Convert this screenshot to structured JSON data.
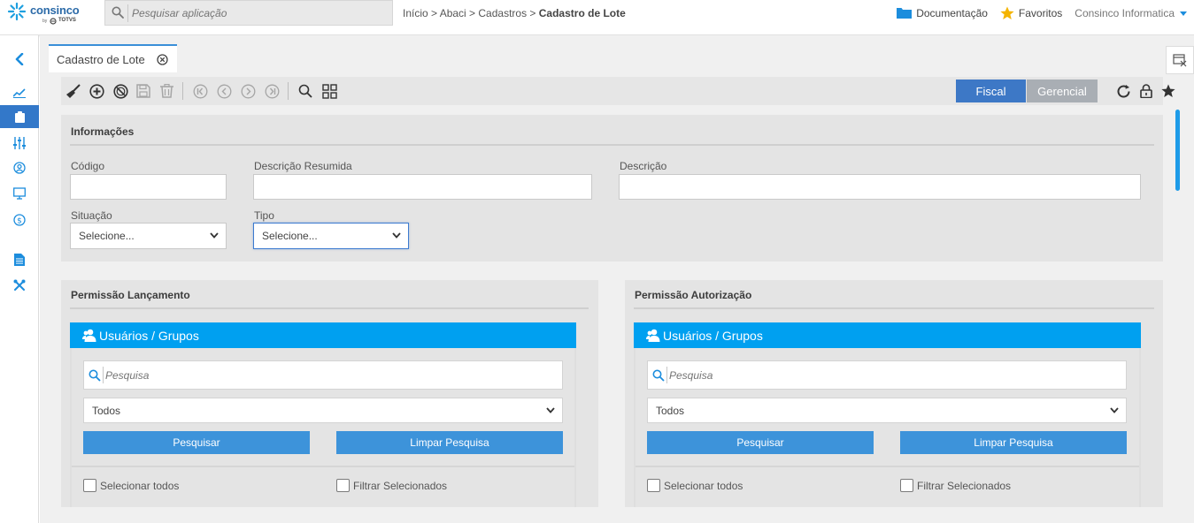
{
  "brand": {
    "name": "consinco",
    "by": "by",
    "partner": "TOTVS"
  },
  "search_app": {
    "placeholder": "Pesquisar aplicação"
  },
  "breadcrumb": {
    "path": "Início > Abaci > Cadastros > ",
    "current": "Cadastro de Lote"
  },
  "header_links": {
    "documentation": "Documentação",
    "favorites": "Favoritos",
    "company": "Consinco Informatica"
  },
  "colors": {
    "accent": "#00a0f0",
    "sidebar_active": "#3378c9",
    "fiscal": "#3d78c6",
    "gerencial": "#a9aeb4",
    "button": "#3d93da"
  },
  "tabs": [
    {
      "label": "Cadastro de Lote",
      "icon": "close-circle-icon"
    }
  ],
  "sidebar": [
    {
      "icon": "back-chevron-icon"
    },
    {
      "icon": "chart-line-icon"
    },
    {
      "icon": "clipboard-icon",
      "active": true
    },
    {
      "icon": "sliders-icon"
    },
    {
      "icon": "user-circle-icon"
    },
    {
      "icon": "monitor-icon"
    },
    {
      "icon": "dollar-circle-icon"
    },
    {
      "icon": "document-icon"
    },
    {
      "icon": "tools-icon"
    }
  ],
  "toolbar": {
    "icons": [
      "broom-icon",
      "add-circle-icon",
      "cancel-circle-icon",
      "save-icon",
      "trash-icon",
      "first-icon",
      "prev-icon",
      "next-icon",
      "last-icon",
      "search-icon",
      "grid-icon"
    ],
    "fiscal_label": "Fiscal",
    "gerencial_label": "Gerencial",
    "right_icons": [
      "refresh-icon",
      "lock-icon",
      "star-icon"
    ]
  },
  "informacoes": {
    "title": "Informações",
    "codigo_label": "Código",
    "codigo_value": "",
    "descricao_resumida_label": "Descrição Resumida",
    "descricao_resumida_value": "",
    "descricao_label": "Descrição",
    "descricao_value": "",
    "situacao_label": "Situação",
    "situacao_value": "Selecione...",
    "tipo_label": "Tipo",
    "tipo_value": "Selecione..."
  },
  "permissao_lancamento": {
    "title": "Permissão Lançamento",
    "header": "Usuários / Grupos",
    "search_placeholder": "Pesquisa",
    "filter_value": "Todos",
    "search_button": "Pesquisar",
    "clear_button": "Limpar Pesquisa",
    "select_all": "Selecionar todos",
    "filter_selected": "Filtrar Selecionados"
  },
  "permissao_autorizacao": {
    "title": "Permissão Autorização",
    "header": "Usuários / Grupos",
    "search_placeholder": "Pesquisa",
    "filter_value": "Todos",
    "search_button": "Pesquisar",
    "clear_button": "Limpar Pesquisa",
    "select_all": "Selecionar todos",
    "filter_selected": "Filtrar Selecionados"
  }
}
